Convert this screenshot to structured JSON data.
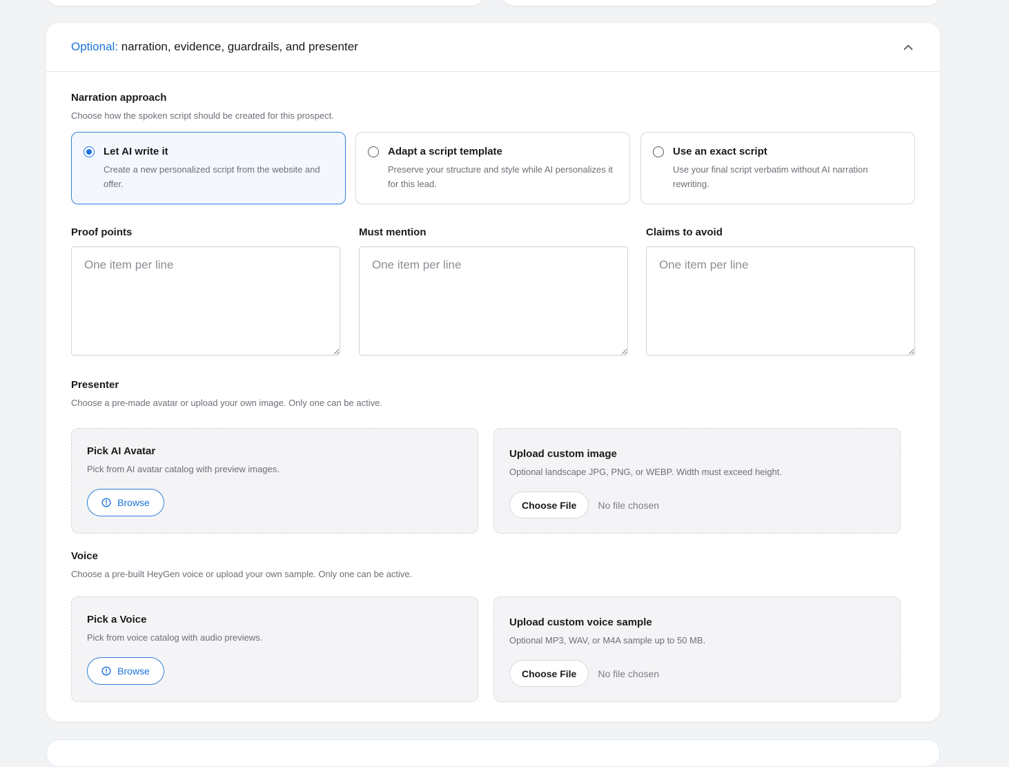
{
  "panel": {
    "title_accent": "Optional:",
    "title_rest": " narration, evidence, guardrails, and presenter"
  },
  "narration": {
    "label": "Narration approach",
    "description": "Choose how the spoken script should be created for this prospect.",
    "options": [
      {
        "title": "Let AI write it",
        "description": "Create a new personalized script from the website and offer."
      },
      {
        "title": "Adapt a script template",
        "description": "Preserve your structure and style while AI personalizes it for this lead."
      },
      {
        "title": "Use an exact script",
        "description": "Use your final script verbatim without AI narration rewriting."
      }
    ],
    "selected": "Let AI write it"
  },
  "fields": [
    {
      "label": "Proof points",
      "placeholder": "One item per line",
      "value": ""
    },
    {
      "label": "Must mention",
      "placeholder": "One item per line",
      "value": ""
    },
    {
      "label": "Claims to avoid",
      "placeholder": "One item per line",
      "value": ""
    }
  ],
  "presenter": {
    "label": "Presenter",
    "description": "Choose a pre-made avatar or upload your own image. Only one can be active.",
    "pick": {
      "title": "Pick AI Avatar",
      "description": "Pick from AI avatar catalog with preview images.",
      "button": "Browse"
    },
    "upload": {
      "title": "Upload custom image",
      "description": "Optional landscape JPG, PNG, or WEBP. Width must exceed height.",
      "button": "Choose File",
      "status": "No file chosen"
    }
  },
  "voice": {
    "label": "Voice",
    "description": "Choose a pre-built HeyGen voice or upload your own sample. Only one can be active.",
    "pick": {
      "title": "Pick a Voice",
      "description": "Pick from voice catalog with audio previews.",
      "button": "Browse"
    },
    "upload": {
      "title": "Upload custom voice sample",
      "description": "Optional MP3, WAV, or M4A sample up to 50 MB.",
      "button": "Choose File",
      "status": "No file chosen"
    }
  },
  "icons": {
    "collapse": "chevron-up-icon",
    "browse": "info-circle-icon"
  },
  "colors": {
    "accent": "#1a73d9",
    "selected_bg": "#f4f8fe",
    "page_bg": "#f2f3f5"
  }
}
